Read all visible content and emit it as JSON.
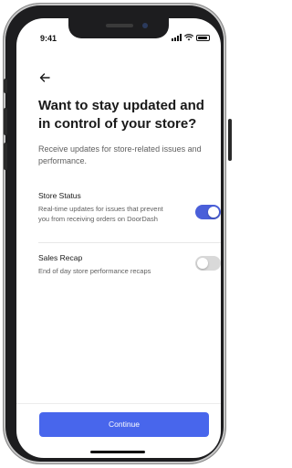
{
  "status_bar": {
    "time": "9:41"
  },
  "page": {
    "title": "Want to stay updated and in control of your store?",
    "subtitle": "Receive updates for store-related issues and performance."
  },
  "settings": [
    {
      "title": "Store Status",
      "description": "Real-time updates for issues that prevent you from receiving orders on DoorDash",
      "enabled": true
    },
    {
      "title": "Sales Recap",
      "description": "End of day store performance recaps",
      "enabled": false
    }
  ],
  "footer": {
    "continue_label": "Continue"
  },
  "icons": {
    "back": "back-arrow-icon",
    "signal": "signal-icon",
    "wifi": "wifi-icon",
    "battery": "battery-icon"
  },
  "colors": {
    "accent": "#4866ec",
    "toggle_on": "#4a5fd9",
    "toggle_off": "#d9d9d9"
  }
}
